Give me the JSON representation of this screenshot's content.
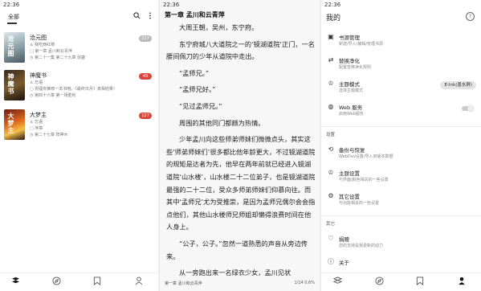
{
  "status_time": "22:36",
  "shelf": {
    "tab_all": "全部",
    "books": [
      {
        "title": "沧元图",
        "author": "我吃西红柿",
        "latest": "第一章 孟川和云青萍",
        "current": "第二十一集 第二十九章 剑塞",
        "badge": "227",
        "badge_style": "grey",
        "cover_text": "沧元图"
      },
      {
        "title": "神魔书",
        "author": "忘语",
        "latest": "祝福你推荐一本书哦，《最终日月》真相结果！",
        "current": "第四十六章 第一场胜利",
        "badge": "49",
        "badge_style": "red",
        "cover_text": "神魔书"
      },
      {
        "title": "大梦主",
        "author": "忘语",
        "latest": "序章",
        "current": "第二十七章 阵神木",
        "badge": "127",
        "badge_style": "red",
        "cover_text": "大梦主"
      }
    ]
  },
  "reader": {
    "chapter_title": "第一章 孟川和云青萍",
    "paragraphs": [
      "大周王朝，吴州，东宁府。",
      "东宁府城八大道院之一的‘镜湖道院’正门，一名腰间佩刀的少年从道院中走出。",
      "“孟师兄。”",
      "“孟师兄好。”",
      "“见过孟师兄。”",
      "周围的其他同门都颇为热情。",
      "少年孟川向这些师弟师妹们微微点头，其实这些‘师弟师妹们’很多都比他年龄更大，不过镜湖道院的规矩是达者为先，他早在两年前就已经进入镜湖道院‘山水楼’，山水楼二十二位弟子，也是镜湖道院最强的二十二位，受众多师弟师妹们仰慕向往。而其中‘孟师兄’尤为受推崇，是因为孟师兄偶尔会会指点他们，其他山水楼师兄师姐却懒得浪费时间在他人身上。",
      "“公子，公子。”忽然一道熟悉的声音从旁边传来。",
      "从一旁跑出来一名绿衣少女，孟川见状"
    ],
    "footer_chapter": "第一章 孟川和云青萍",
    "footer_progress": "1/14  0.6%"
  },
  "my": {
    "title": "我的",
    "items": [
      {
        "id": "source",
        "icon": "book-icon",
        "glyph": "▣",
        "title": "书源管理",
        "sub": "新建/导入/编辑/管理书源"
      },
      {
        "id": "replace",
        "icon": "replace-icon",
        "glyph": "⇄",
        "title": "替换净化",
        "sub": "配置替换净化规则"
      },
      {
        "id": "theme",
        "icon": "shirt-icon",
        "glyph": "♔",
        "title": "主题模式",
        "sub": "选择主题模式",
        "pill": "E-Ink(墨水屏)"
      },
      {
        "id": "web",
        "icon": "globe-icon",
        "glyph": "◍",
        "title": "Web 服务",
        "sub": "启用Web服务"
      }
    ],
    "section_settings": "设置",
    "settings": [
      {
        "id": "backup",
        "icon": "backup-icon",
        "glyph": "⟲",
        "title": "备份与恢复",
        "sub": "WebDav设置/导入旧版本数据"
      },
      {
        "id": "themesetting",
        "icon": "shirt-icon",
        "glyph": "♔",
        "title": "主题设置",
        "sub": "与界面/颜色相关的一些设置"
      },
      {
        "id": "other",
        "icon": "gear-icon",
        "glyph": "⚙",
        "title": "其它设置",
        "sub": "与功能相关的一些设置"
      }
    ],
    "section_other": "其它",
    "others": [
      {
        "id": "donate",
        "icon": "heart-icon",
        "glyph": "♡",
        "title": "捐赠",
        "sub": "您的支持是我更新的动力"
      },
      {
        "id": "about",
        "icon": "info-icon",
        "glyph": "ⓘ",
        "title": "关于",
        "sub": ""
      }
    ]
  },
  "nav_icons": [
    "bookshelf-icon",
    "compass-icon",
    "rss-icon",
    "profile-icon"
  ]
}
